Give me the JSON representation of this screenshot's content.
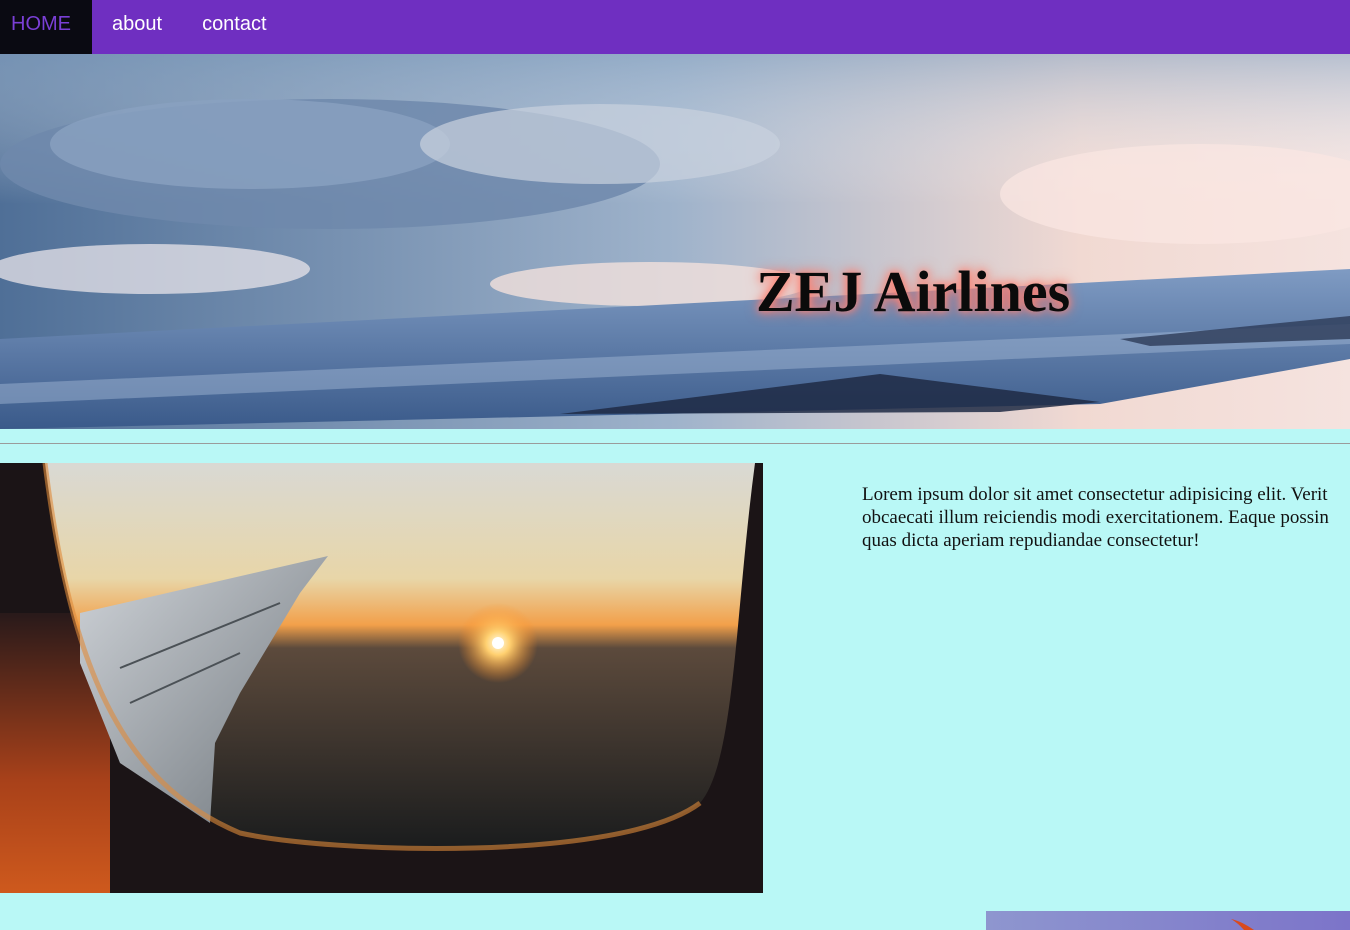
{
  "nav": {
    "items": [
      {
        "label": "HOME",
        "active": true
      },
      {
        "label": "about",
        "active": false
      },
      {
        "label": "contact",
        "active": false
      }
    ],
    "colors": {
      "background": "#6f2fc1",
      "active_bg": "#0a0a12",
      "active_text": "#7a3fd6",
      "text": "#ffffff"
    }
  },
  "hero": {
    "title": "ZEJ Airlines",
    "image": "airplane-wing-clouds-banner"
  },
  "content": {
    "image": "airplane-window-sunset-photo",
    "text": "Lorem ipsum dolor sit amet consectetur adipisicing elit. Verit\nobcaecati illum reiciendis modi exercitationem. Eaque possin\nquas dicta aperiam repudiandae consectetur!",
    "background": "#b9f8f6"
  },
  "footer_image": "airplane-tail-photo"
}
